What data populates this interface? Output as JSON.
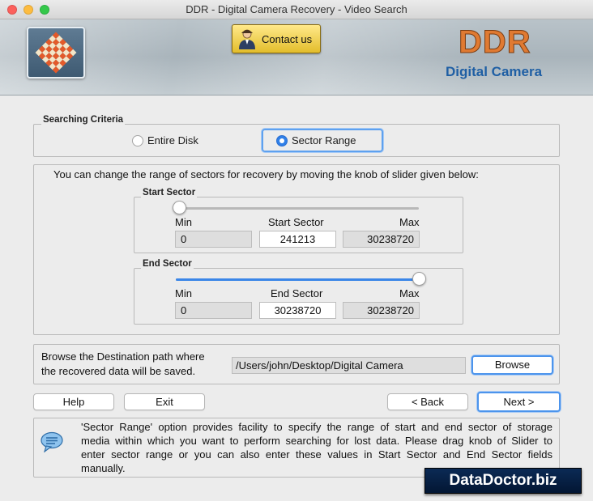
{
  "window": {
    "title": "DDR - Digital Camera Recovery - Video Search"
  },
  "header": {
    "contact_label": "Contact us",
    "brand": "DDR",
    "product": "Digital Camera",
    "brand_color": "#e07a32",
    "product_color": "#1f5fa4"
  },
  "criteria": {
    "title": "Searching Criteria",
    "options": [
      {
        "label": "Entire Disk",
        "selected": false
      },
      {
        "label": "Sector Range",
        "selected": true
      }
    ]
  },
  "range": {
    "instruction": "You can change the range of sectors for recovery by moving the knob of slider given below:",
    "start": {
      "title": "Start Sector",
      "min_label": "Min",
      "value_label": "Start Sector",
      "max_label": "Max",
      "min": "0",
      "value": "241213",
      "max": "30238720",
      "slider_fraction": 0.008
    },
    "end": {
      "title": "End Sector",
      "min_label": "Min",
      "value_label": "End Sector",
      "max_label": "Max",
      "min": "0",
      "value": "30238720",
      "max": "30238720",
      "slider_fraction": 1.0
    }
  },
  "destination": {
    "prompt_line1": "Browse the Destination path where",
    "prompt_line2": "the recovered data will be saved.",
    "path": "/Users/john/Desktop/Digital Camera",
    "browse_label": "Browse"
  },
  "buttons": {
    "help": "Help",
    "exit": "Exit",
    "back": "< Back",
    "next": "Next >"
  },
  "info": {
    "line1": "'Sector Range' option provides facility to specify the range of start and end sector of storage",
    "line2": "media within which you want to perform searching for lost data. Please drag knob of Slider to",
    "line3": "enter sector range or you can also enter these values in Start Sector and End Sector fields",
    "line4": "manually."
  },
  "footer_badge": "DataDoctor.biz",
  "icons": [
    "ddr-logo-icon",
    "contact-person-icon",
    "info-bubble-icon"
  ]
}
